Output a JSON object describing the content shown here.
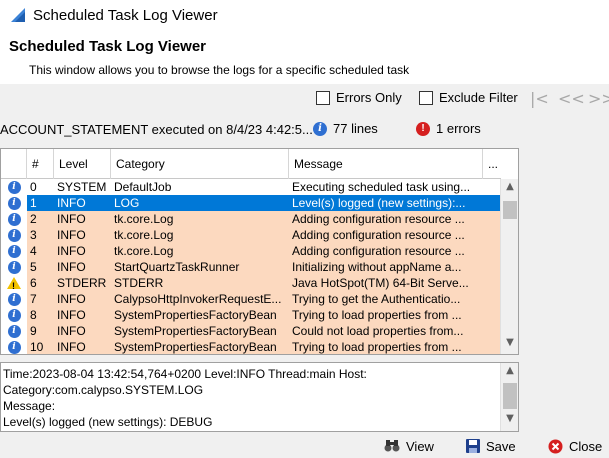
{
  "window": {
    "title": "Scheduled Task Log Viewer"
  },
  "header": {
    "title": "Scheduled Task Log Viewer",
    "description": "This window allows you to browse the logs for a specific scheduled task"
  },
  "toolbar": {
    "errors_only": "Errors Only",
    "exclude_filter": "Exclude Filter",
    "errors_only_checked": false,
    "exclude_filter_checked": false,
    "nav": [
      "|<",
      "<<",
      ">>"
    ]
  },
  "info": {
    "task_text": "ACCOUNT_STATEMENT executed on 8/4/23 4:42:5...",
    "lines": "77 lines",
    "errors": "1 errors"
  },
  "table": {
    "columns": [
      "",
      "#",
      "Level",
      "Category",
      "Message",
      "..."
    ],
    "rows": [
      {
        "icon": "info-icon",
        "num": "0",
        "level": "SYSTEM",
        "category": "DefaultJob",
        "message": "Executing scheduled task using...",
        "style": "white"
      },
      {
        "icon": "info-icon",
        "num": "1",
        "level": "INFO",
        "category": "LOG",
        "message": "Level(s) logged (new settings):...",
        "style": "selected"
      },
      {
        "icon": "info-icon",
        "num": "2",
        "level": "INFO",
        "category": "tk.core.Log",
        "message": "Adding configuration resource ...",
        "style": "orange"
      },
      {
        "icon": "info-icon",
        "num": "3",
        "level": "INFO",
        "category": "tk.core.Log",
        "message": "Adding configuration resource ...",
        "style": "orange"
      },
      {
        "icon": "info-icon",
        "num": "4",
        "level": "INFO",
        "category": "tk.core.Log",
        "message": "Adding configuration resource ...",
        "style": "orange"
      },
      {
        "icon": "info-icon",
        "num": "5",
        "level": "INFO",
        "category": "StartQuartzTaskRunner",
        "message": "Initializing without appName a...",
        "style": "orange"
      },
      {
        "icon": "warning-icon",
        "num": "6",
        "level": "STDERR",
        "category": "STDERR",
        "message": "Java HotSpot(TM) 64-Bit Serve...",
        "style": "orange"
      },
      {
        "icon": "info-icon",
        "num": "7",
        "level": "INFO",
        "category": "CalypsoHttpInvokerRequestE...",
        "message": "Trying to get the Authenticatio...",
        "style": "orange"
      },
      {
        "icon": "info-icon",
        "num": "8",
        "level": "INFO",
        "category": "SystemPropertiesFactoryBean",
        "message": "Trying to load properties from ...",
        "style": "orange"
      },
      {
        "icon": "info-icon",
        "num": "9",
        "level": "INFO",
        "category": "SystemPropertiesFactoryBean",
        "message": "Could not load properties from...",
        "style": "orange"
      },
      {
        "icon": "info-icon",
        "num": "10",
        "level": "INFO",
        "category": "SystemPropertiesFactoryBean",
        "message": "Trying to load properties from ...",
        "style": "orange"
      }
    ]
  },
  "detail": {
    "lines": [
      "Time:2023-08-04 13:42:54,764+0200 Level:INFO Thread:main Host:",
      "Category:com.calypso.SYSTEM.LOG",
      "Message:",
      "Level(s) logged (new settings): DEBUG"
    ]
  },
  "buttons": {
    "view": "View",
    "save": "Save",
    "close": "Close"
  },
  "colors": {
    "selected": "#0078d7",
    "orange_row": "#fcd9bf",
    "info": "#2f6fd1",
    "error": "#d51f1f",
    "warning": "#f2c200"
  }
}
